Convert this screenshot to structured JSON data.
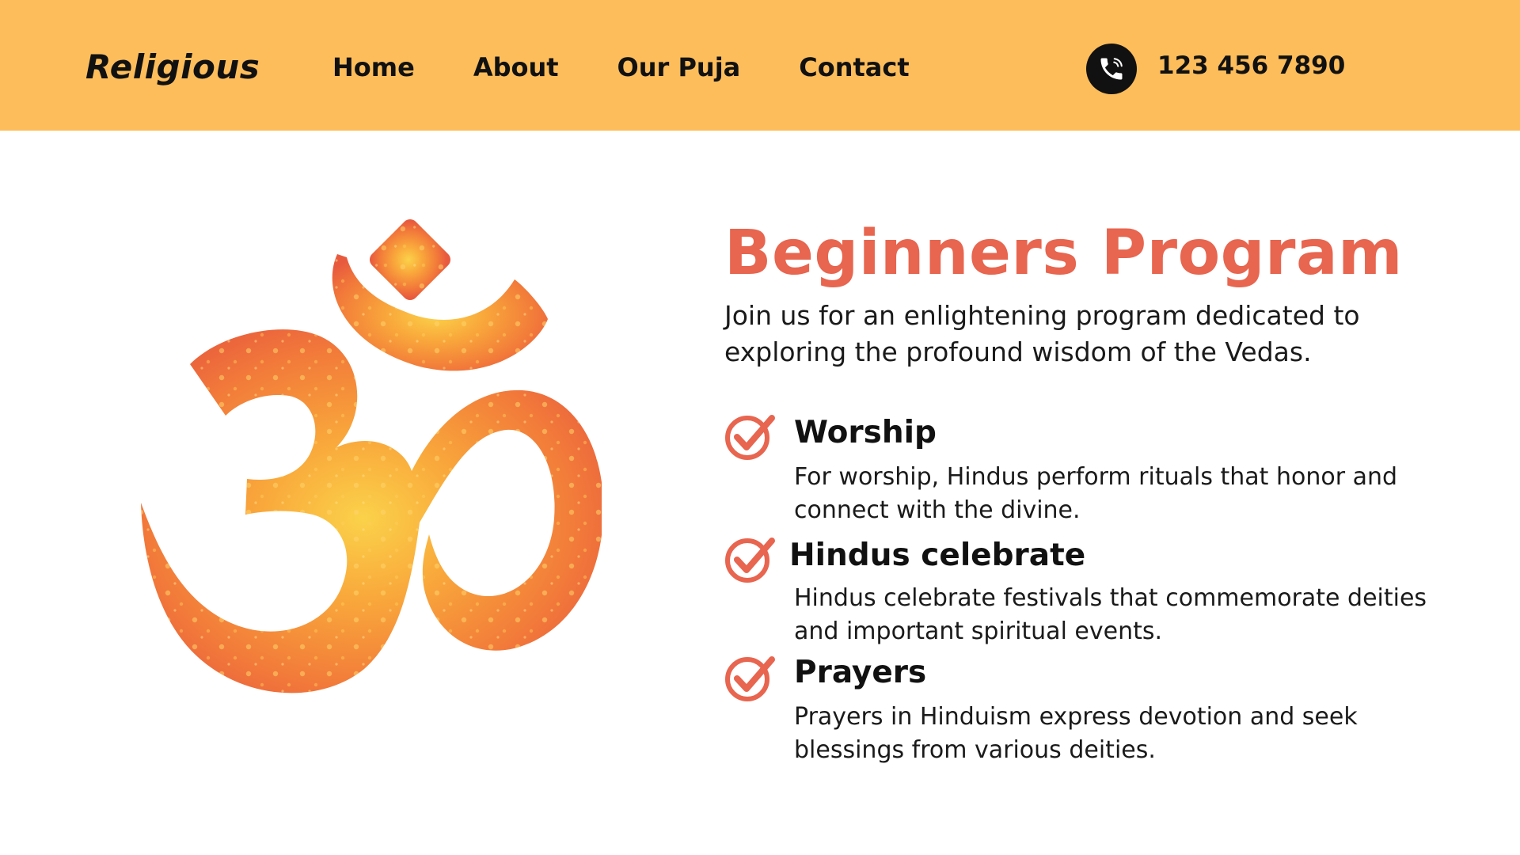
{
  "header": {
    "logo": "Religious",
    "nav": [
      "Home",
      "About",
      "Our Puja",
      "Contact"
    ],
    "phone": "123 456 7890"
  },
  "hero": {
    "title": "Beginners Program",
    "intro": "Join us for an enlightening program dedicated to exploring the profound wisdom of the Vedas.",
    "features": [
      {
        "title": "Worship",
        "description": "For worship, Hindus perform rituals that honor and connect with the divine."
      },
      {
        "title": "Hindus celebrate",
        "description": "Hindus celebrate festivals that commemorate deities and important spiritual events."
      },
      {
        "title": "Prayers",
        "description": "Prayers in Hinduism express devotion and seek blessings from various deities."
      }
    ]
  },
  "colors": {
    "header_bg": "#fdbd5b",
    "accent": "#e8654f",
    "text": "#111111"
  },
  "icons": {
    "phone": "phone-icon",
    "check": "check-circle-icon",
    "om": "om-symbol-icon"
  }
}
